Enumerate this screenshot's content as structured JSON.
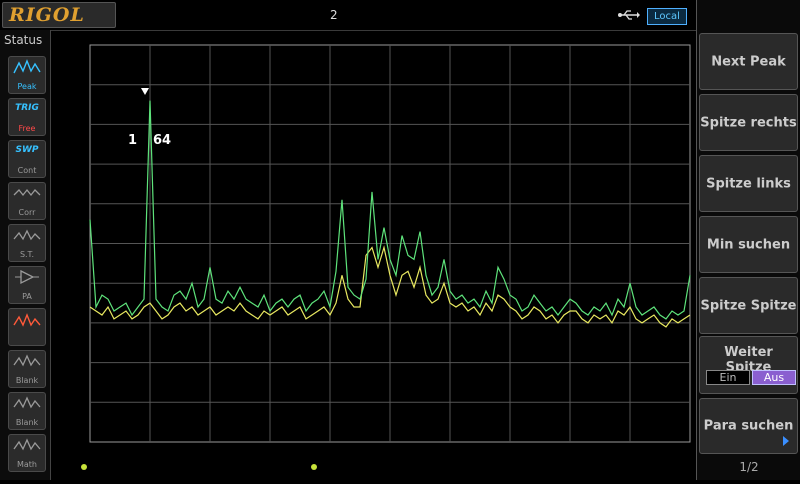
{
  "brand": "RIGOL",
  "header": {
    "title": "2",
    "remote_status": "Local"
  },
  "status_panel": {
    "title": "Status",
    "items": [
      {
        "top": "",
        "label": "Peak",
        "color": "#36c1ff"
      },
      {
        "top": "TRIG",
        "label": "Free",
        "color": "#ff4a4a"
      },
      {
        "top": "SWP",
        "label": "Cont",
        "color": "#36c1ff"
      },
      {
        "top": "",
        "label": "Corr",
        "color": "#9a9a9a"
      },
      {
        "top": "",
        "label": "S.T.",
        "color": "#9a9a9a"
      },
      {
        "top": "",
        "label": "PA",
        "color": "#9a9a9a"
      },
      {
        "top": "",
        "label": "",
        "color": "#ff5a3a"
      },
      {
        "top": "",
        "label": "Blank",
        "color": "#9a9a9a"
      },
      {
        "top": "",
        "label": "Blank",
        "color": "#9a9a9a"
      },
      {
        "top": "",
        "label": "Math",
        "color": "#9a9a9a"
      }
    ]
  },
  "marker": {
    "label": "1",
    "value": "64"
  },
  "menu": {
    "title": "",
    "buttons": [
      "Next Peak",
      "Spitze rechts",
      "Spitze links",
      "Min suchen",
      "Spitze Spitze"
    ],
    "toggle": {
      "label": "Weiter Spitze",
      "on": "Ein",
      "off": "Aus",
      "selected": "Aus"
    },
    "para": "Para suchen",
    "page": "1/2"
  },
  "chart_data": {
    "type": "line",
    "title": "",
    "xlabel": "",
    "ylabel": "",
    "grid": true,
    "x": [
      0,
      1,
      2,
      3,
      4,
      5,
      6,
      7,
      8,
      9,
      10,
      11,
      12,
      13,
      14,
      15,
      16,
      17,
      18,
      19,
      20,
      21,
      22,
      23,
      24,
      25,
      26,
      27,
      28,
      29,
      30,
      31,
      32,
      33,
      34,
      35,
      36,
      37,
      38,
      39,
      40,
      41,
      42,
      43,
      44,
      45,
      46,
      47,
      48,
      49,
      50,
      51,
      52,
      53,
      54,
      55,
      56,
      57,
      58,
      59,
      60,
      61,
      62,
      63,
      64,
      65,
      66,
      67,
      68,
      69,
      70,
      71,
      72,
      73,
      74,
      75,
      76,
      77,
      78,
      79,
      80,
      81,
      82,
      83,
      84,
      85,
      86,
      87,
      88,
      89,
      90,
      91,
      92,
      93,
      94,
      95,
      96,
      97,
      98,
      99,
      100
    ],
    "series": [
      {
        "color": "#5ee37b",
        "values": [
          5.6,
          3.4,
          3.7,
          3.6,
          3.3,
          3.4,
          3.5,
          3.2,
          3.4,
          3.6,
          8.6,
          3.6,
          3.4,
          3.3,
          3.7,
          3.8,
          3.6,
          4.0,
          3.4,
          3.6,
          4.4,
          3.6,
          3.5,
          3.8,
          3.6,
          3.9,
          3.6,
          3.5,
          3.4,
          3.7,
          3.3,
          3.5,
          3.6,
          3.4,
          3.6,
          3.7,
          3.3,
          3.5,
          3.6,
          3.8,
          3.4,
          4.3,
          6.1,
          3.9,
          3.7,
          3.6,
          4.1,
          6.3,
          4.6,
          5.4,
          4.6,
          4.2,
          5.2,
          4.7,
          4.6,
          5.3,
          4.2,
          3.7,
          3.9,
          4.6,
          3.8,
          3.6,
          3.7,
          3.5,
          3.6,
          3.4,
          3.8,
          3.5,
          4.4,
          4.1,
          3.7,
          3.6,
          3.3,
          3.4,
          3.7,
          3.5,
          3.3,
          3.4,
          3.2,
          3.4,
          3.6,
          3.5,
          3.3,
          3.2,
          3.4,
          3.3,
          3.5,
          3.2,
          3.6,
          3.4,
          4.0,
          3.4,
          3.2,
          3.3,
          3.4,
          3.2,
          3.1,
          3.3,
          3.2,
          3.3,
          4.2
        ]
      },
      {
        "color": "#e8e860",
        "values": [
          3.4,
          3.3,
          3.2,
          3.4,
          3.1,
          3.2,
          3.3,
          3.1,
          3.2,
          3.4,
          3.5,
          3.3,
          3.1,
          3.2,
          3.4,
          3.5,
          3.3,
          3.4,
          3.2,
          3.3,
          3.4,
          3.2,
          3.3,
          3.4,
          3.3,
          3.5,
          3.3,
          3.2,
          3.1,
          3.3,
          3.2,
          3.3,
          3.4,
          3.2,
          3.3,
          3.4,
          3.1,
          3.2,
          3.3,
          3.4,
          3.2,
          3.5,
          4.2,
          3.6,
          3.4,
          3.4,
          4.7,
          4.9,
          4.4,
          4.9,
          4.2,
          3.7,
          4.2,
          4.3,
          3.9,
          4.4,
          3.7,
          3.5,
          3.6,
          4.0,
          3.5,
          3.4,
          3.5,
          3.3,
          3.4,
          3.2,
          3.5,
          3.3,
          3.7,
          3.6,
          3.4,
          3.3,
          3.1,
          3.2,
          3.4,
          3.3,
          3.1,
          3.2,
          3.0,
          3.2,
          3.3,
          3.3,
          3.1,
          3.0,
          3.2,
          3.1,
          3.2,
          3.0,
          3.3,
          3.2,
          3.4,
          3.1,
          3.0,
          3.1,
          3.2,
          3.0,
          2.9,
          3.1,
          3.0,
          3.1,
          3.2
        ]
      }
    ],
    "xlim": [
      0,
      100
    ],
    "ylim": [
      0,
      10
    ]
  }
}
